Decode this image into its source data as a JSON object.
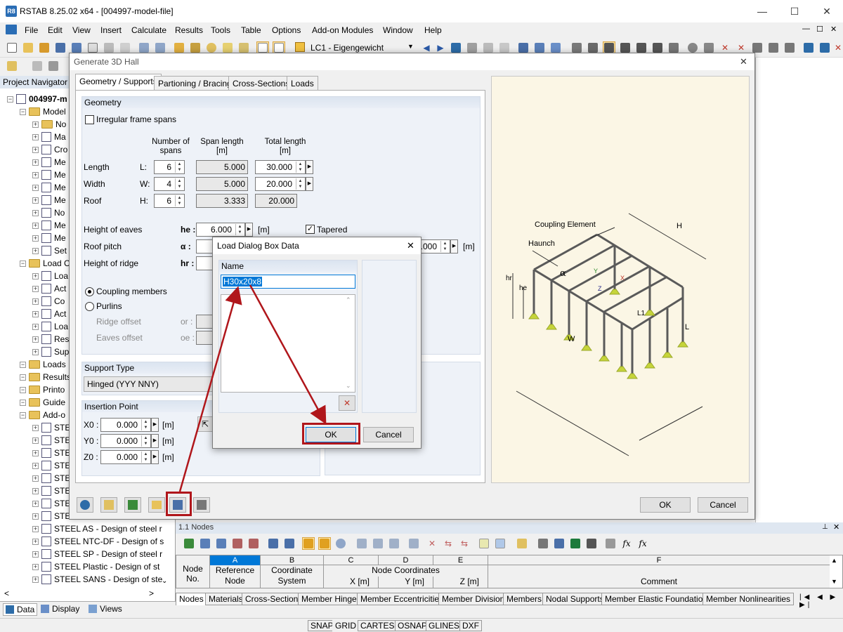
{
  "app": {
    "title": "RSTAB 8.25.02 x64 - [004997-model-file]",
    "logo_label": "R8",
    "window_controls": {
      "minimize": "—",
      "maximize": "☐",
      "close": "✕",
      "doc_close": "✕"
    }
  },
  "menu": [
    "File",
    "Edit",
    "View",
    "Insert",
    "Calculate",
    "Results",
    "Tools",
    "Table",
    "Options",
    "Add-on Modules",
    "Window",
    "Help"
  ],
  "toolbar": {
    "load_case": "LC1 - Eigengewicht"
  },
  "navigator": {
    "title": "Project Navigator -",
    "root": "004997-m",
    "items": [
      {
        "label": "Model",
        "level": 1,
        "type": "folder"
      },
      {
        "label": "No",
        "level": 2,
        "type": "folder"
      },
      {
        "label": "Ma",
        "level": 2,
        "type": "doc"
      },
      {
        "label": "Cro",
        "level": 2,
        "type": "doc"
      },
      {
        "label": "Me",
        "level": 2,
        "type": "doc"
      },
      {
        "label": "Me",
        "level": 2,
        "type": "doc"
      },
      {
        "label": "Me",
        "level": 2,
        "type": "doc"
      },
      {
        "label": "Me",
        "level": 2,
        "type": "doc"
      },
      {
        "label": "No",
        "level": 2,
        "type": "doc"
      },
      {
        "label": "Me",
        "level": 2,
        "type": "doc"
      },
      {
        "label": "Me",
        "level": 2,
        "type": "doc"
      },
      {
        "label": "Set",
        "level": 2,
        "type": "doc"
      },
      {
        "label": "Load C",
        "level": 1,
        "type": "folder"
      },
      {
        "label": "Loa",
        "level": 2,
        "type": "doc"
      },
      {
        "label": "Act",
        "level": 2,
        "type": "doc"
      },
      {
        "label": "Co",
        "level": 2,
        "type": "doc"
      },
      {
        "label": "Act",
        "level": 2,
        "type": "doc"
      },
      {
        "label": "Loa",
        "level": 2,
        "type": "doc"
      },
      {
        "label": "Res",
        "level": 2,
        "type": "doc"
      },
      {
        "label": "Sup",
        "level": 2,
        "type": "doc"
      },
      {
        "label": "Loads",
        "level": 1,
        "type": "folder"
      },
      {
        "label": "Results",
        "level": 1,
        "type": "folder"
      },
      {
        "label": "Printo",
        "level": 1,
        "type": "folder"
      },
      {
        "label": "Guide",
        "level": 1,
        "type": "folder"
      },
      {
        "label": "Add-o",
        "level": 1,
        "type": "folder"
      },
      {
        "label": "STE",
        "level": 2,
        "type": "doc"
      },
      {
        "label": "STE",
        "level": 2,
        "type": "doc"
      },
      {
        "label": "STE",
        "level": 2,
        "type": "doc"
      },
      {
        "label": "STE",
        "level": 2,
        "type": "doc"
      },
      {
        "label": "STE",
        "level": 2,
        "type": "doc"
      },
      {
        "label": "STE",
        "level": 2,
        "type": "doc"
      },
      {
        "label": "STE",
        "level": 2,
        "type": "doc"
      },
      {
        "label": "STE",
        "level": 2,
        "type": "doc"
      },
      {
        "label": "STEEL AS - Design of steel r",
        "level": 2,
        "type": "doc"
      },
      {
        "label": "STEEL NTC-DF - Design of s",
        "level": 2,
        "type": "doc"
      },
      {
        "label": "STEEL SP - Design of steel r",
        "level": 2,
        "type": "doc"
      },
      {
        "label": "STEEL Plastic - Design of st",
        "level": 2,
        "type": "doc"
      },
      {
        "label": "STEEL SANS - Design of ste",
        "level": 2,
        "type": "doc"
      }
    ],
    "bottom_tabs": [
      "Data",
      "Display",
      "Views"
    ]
  },
  "dialog": {
    "title": "Generate 3D Hall",
    "tabs": [
      "Geometry / Supports",
      "Partioning / Bracing",
      "Cross-Sections",
      "Loads"
    ],
    "geometry": {
      "header": "Geometry",
      "irregular_label": "Irregular frame spans",
      "col_spans": "Number of\nspans",
      "col_span_length": "Span length\n[m]",
      "col_total_length": "Total length\n[m]",
      "rows": [
        {
          "name": "Length",
          "sym": "L:",
          "spans": "6",
          "span_length": "5.000",
          "total": "30.000"
        },
        {
          "name": "Width",
          "sym": "W:",
          "spans": "4",
          "span_length": "5.000",
          "total": "20.000"
        },
        {
          "name": "Roof",
          "sym": "H:",
          "spans": "6",
          "span_length": "3.333",
          "total": "20.000"
        }
      ],
      "eaves_label": "Height of eaves",
      "eaves_sym": "he :",
      "eaves_value": "6.000",
      "eaves_unit": "[m]",
      "tapered_label": "Tapered",
      "pitch_label": "Roof pitch",
      "pitch_sym": "α :",
      "pitch_value": ".000",
      "pitch_unit": "[m]",
      "ridge_label": "Height of ridge",
      "ridge_sym": "hr :",
      "coupling_label": "Coupling members",
      "purlins_label": "Purlins",
      "ridge_offset_label": "Ridge offset",
      "ridge_offset_sym": "or :",
      "eaves_offset_label": "Eaves offset",
      "eaves_offset_sym": "oe :"
    },
    "support": {
      "header": "Support Type",
      "value": "Hinged (YYY NNY)"
    },
    "insertion": {
      "header": "Insertion Point",
      "rows": [
        {
          "sym": "X0 :",
          "value": "0.000",
          "unit": "[m]"
        },
        {
          "sym": "Y0 :",
          "value": "0.000",
          "unit": "[m]"
        },
        {
          "sym": "Z0 :",
          "value": "0.000",
          "unit": "[m]"
        }
      ]
    },
    "diagram": {
      "coupling": "Coupling Element",
      "haunch": "Haunch",
      "H": "H",
      "hr": "hr",
      "he": "he",
      "alpha": "α",
      "L1": "L1",
      "L": "L",
      "W": "W",
      "axis_x": "X",
      "axis_y": "Y",
      "axis_z": "Z"
    },
    "ok": "OK",
    "cancel": "Cancel"
  },
  "load_dialog": {
    "title": "Load Dialog Box Data",
    "name_header": "Name",
    "name_value": "H30x20x8",
    "ok": "OK",
    "cancel": "Cancel"
  },
  "table": {
    "title": "1.1 Nodes",
    "col_letters": [
      "A",
      "B",
      "C",
      "D",
      "E",
      "F"
    ],
    "col_node_no": "Node\nNo.",
    "col_ref": "Reference\nNode",
    "col_coord": "Coordinate\nSystem",
    "col_node_coords": "Node Coordinates",
    "col_x": "X [m]",
    "col_y": "Y [m]",
    "col_z": "Z [m]",
    "col_comment": "Comment",
    "tabs": [
      "Nodes",
      "Materials",
      "Cross-Sections",
      "Member Hinges",
      "Member Eccentricities",
      "Member Divisions",
      "Members",
      "Nodal Supports",
      "Member Elastic Foundations",
      "Member Nonlinearities"
    ]
  },
  "status": [
    "SNAP",
    "GRID",
    "CARTES",
    "OSNAP",
    "GLINES",
    "DXF"
  ],
  "colors": {
    "accent_red": "#b0161b",
    "selection_blue": "#0078d7",
    "group_header": "#dbe4f0"
  }
}
